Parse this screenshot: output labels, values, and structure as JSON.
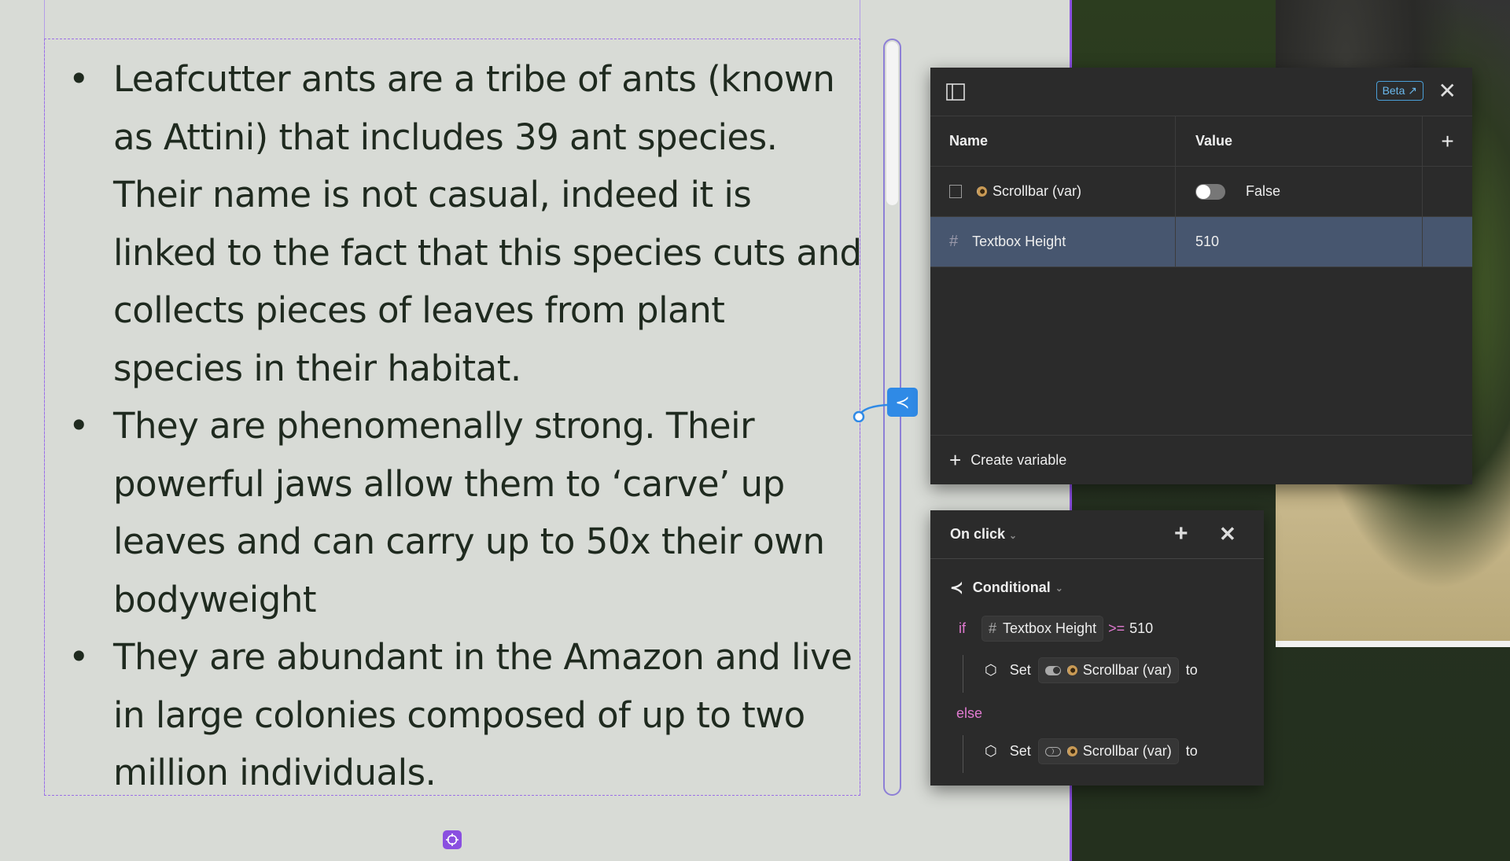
{
  "textbox": {
    "bullets": [
      "Leafcutter ants are a tribe of ants (known as Attini) that includes 39 ant species. Their name is not casual, indeed it is linked to the fact that this species cuts and collects pieces of leaves from plant species in their habitat.",
      "They are phenomenally strong. Their powerful jaws allow them to ‘carve’ up leaves and can carry up to 50x their own bodyweight",
      "They are abundant in the Amazon and live in large colonies composed of up to two million individuals."
    ]
  },
  "variables_panel": {
    "beta_label": "Beta",
    "columns": {
      "name": "Name",
      "value": "Value"
    },
    "rows": [
      {
        "name": "Scrollbar (var)",
        "type": "boolean",
        "value": "False"
      },
      {
        "name": "Textbox Height",
        "type": "number",
        "value": "510",
        "selected": true
      }
    ],
    "create_label": "Create variable"
  },
  "interaction_panel": {
    "trigger": "On click",
    "action": "Conditional",
    "if_kw": "if",
    "condition": {
      "variable": "Textbox Height",
      "operator": ">=",
      "value": "510"
    },
    "then": {
      "set": "Set",
      "variable": "Scrollbar (var)",
      "to": "to"
    },
    "else_kw": "else",
    "else": {
      "set": "Set",
      "variable": "Scrollbar (var)",
      "to": "to"
    }
  },
  "colors": {
    "accent_purple": "#8a4fe0",
    "conditional_blue": "#2f8ae6",
    "selected_row": "#47566f",
    "keyword_pink": "#e07ad0"
  }
}
